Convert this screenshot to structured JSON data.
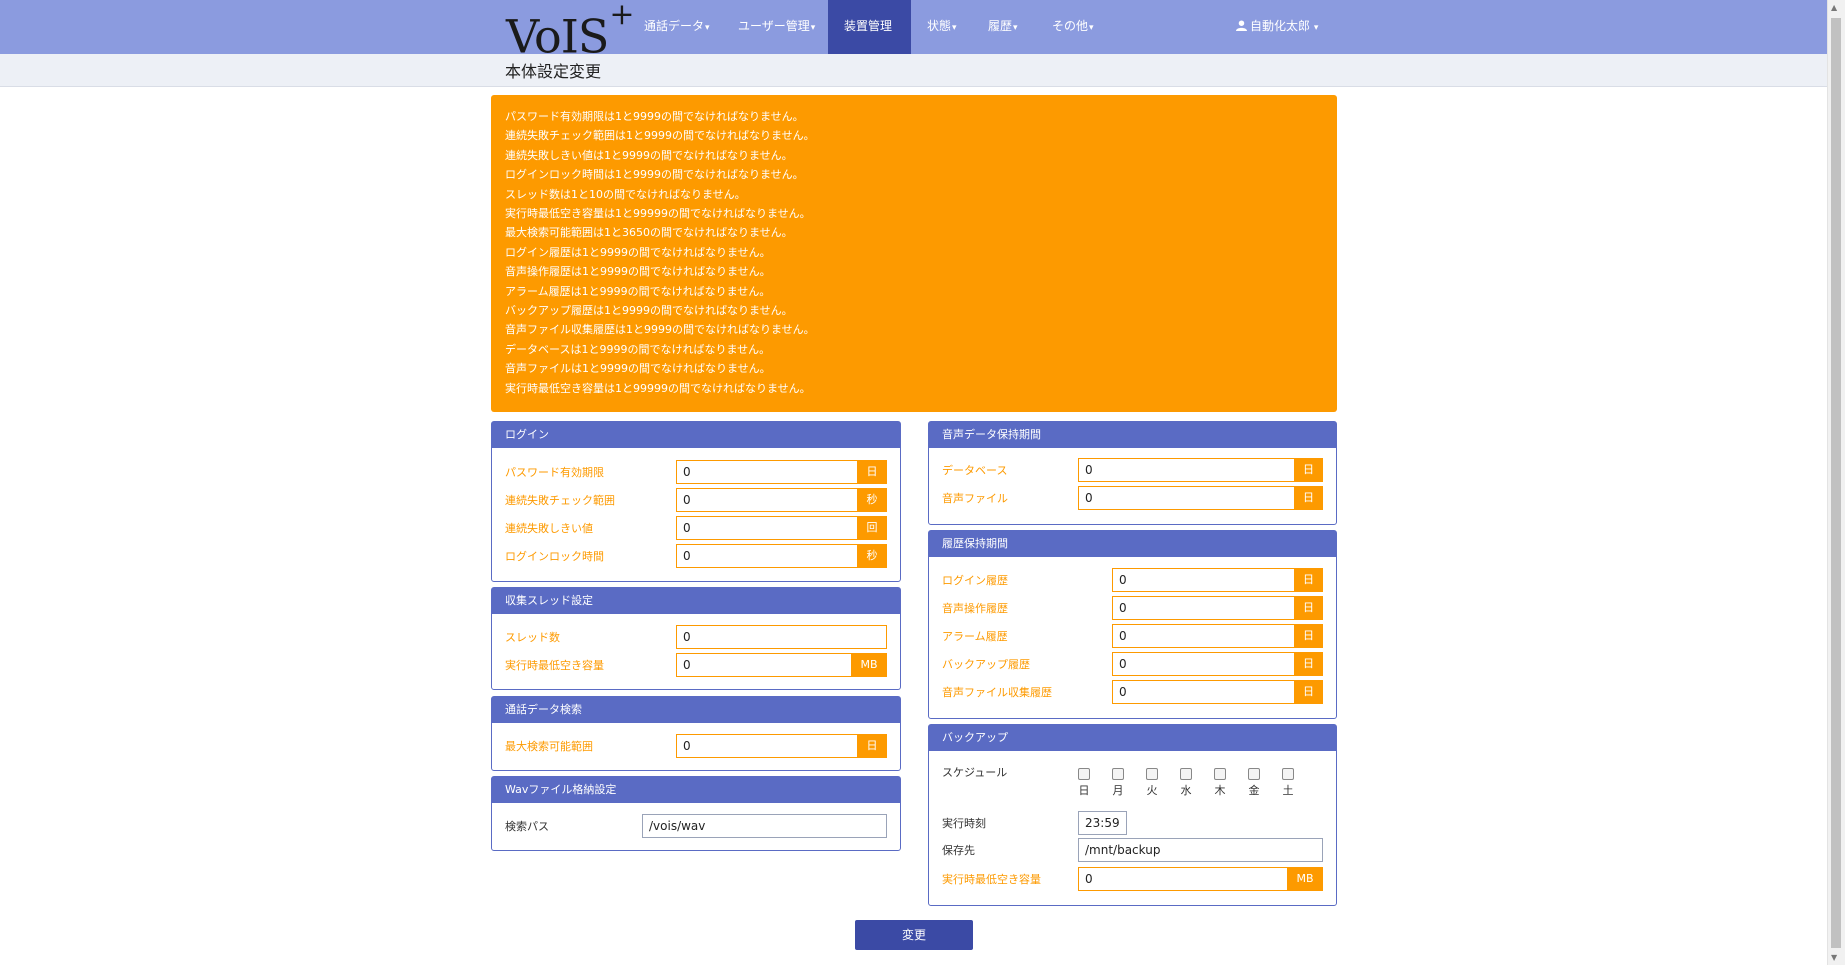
{
  "nav": {
    "logo_main": "VoIS",
    "logo_plus": "+",
    "items": [
      {
        "label": "通話データ"
      },
      {
        "label": "ユーザー管理"
      },
      {
        "label": "装置管理"
      },
      {
        "label": "状態"
      },
      {
        "label": "履歴"
      },
      {
        "label": "その他"
      }
    ],
    "active_index": 2,
    "user": "自動化太郎"
  },
  "page": {
    "title": "本体設定変更"
  },
  "alert": {
    "color": "#fd9a00",
    "messages": [
      "パスワード有効期限は1と9999の間でなければなりません。",
      "連続失敗チェック範囲は1と9999の間でなければなりません。",
      "連続失敗しきい値は1と9999の間でなければなりません。",
      "ログインロック時間は1と9999の間でなければなりません。",
      "スレッド数は1と10の間でなければなりません。",
      "実行時最低空き容量は1と99999の間でなければなりません。",
      "最大検索可能範囲は1と3650の間でなければなりません。",
      "ログイン履歴は1と9999の間でなければなりません。",
      "音声操作履歴は1と9999の間でなければなりません。",
      "アラーム履歴は1と9999の間でなければなりません。",
      "バックアップ履歴は1と9999の間でなければなりません。",
      "音声ファイル収集履歴は1と9999の間でなければなりません。",
      "データベースは1と9999の間でなければなりません。",
      "音声ファイルは1と9999の間でなければなりません。",
      "実行時最低空き容量は1と99999の間でなければなりません。"
    ]
  },
  "login": {
    "title": "ログイン",
    "rows": [
      {
        "label": "パスワード有効期限",
        "value": "0",
        "unit": "日"
      },
      {
        "label": "連続失敗チェック範囲",
        "value": "0",
        "unit": "秒"
      },
      {
        "label": "連続失敗しきい値",
        "value": "0",
        "unit": "回"
      },
      {
        "label": "ログインロック時間",
        "value": "0",
        "unit": "秒"
      }
    ]
  },
  "thread": {
    "title": "収集スレッド設定",
    "rows": [
      {
        "label": "スレッド数",
        "value": "0"
      },
      {
        "label": "実行時最低空き容量",
        "value": "0",
        "unit": "MB"
      }
    ]
  },
  "search": {
    "title": "通話データ検索",
    "rows": [
      {
        "label": "最大検索可能範囲",
        "value": "0",
        "unit": "日"
      }
    ]
  },
  "wav": {
    "title": "Wavファイル格納設定",
    "rows": [
      {
        "label": "検索パス",
        "value": "/vois/wav"
      }
    ]
  },
  "voice": {
    "title": "音声データ保持期間",
    "rows": [
      {
        "label": "データベース",
        "value": "0",
        "unit": "日"
      },
      {
        "label": "音声ファイル",
        "value": "0",
        "unit": "日"
      }
    ]
  },
  "history": {
    "title": "履歴保持期間",
    "rows": [
      {
        "label": "ログイン履歴",
        "value": "0",
        "unit": "日"
      },
      {
        "label": "音声操作履歴",
        "value": "0",
        "unit": "日"
      },
      {
        "label": "アラーム履歴",
        "value": "0",
        "unit": "日"
      },
      {
        "label": "バックアップ履歴",
        "value": "0",
        "unit": "日"
      },
      {
        "label": "音声ファイル収集履歴",
        "value": "0",
        "unit": "日"
      }
    ]
  },
  "backup": {
    "title": "バックアップ",
    "schedule_label": "スケジュール",
    "days": [
      "日",
      "月",
      "火",
      "水",
      "木",
      "金",
      "土"
    ],
    "time_label": "実行時刻",
    "time_value": "23:59",
    "dest_label": "保存先",
    "dest_value": "/mnt/backup",
    "free_label": "実行時最低空き容量",
    "free_value": "0",
    "free_unit": "MB"
  },
  "submit_label": "変更"
}
